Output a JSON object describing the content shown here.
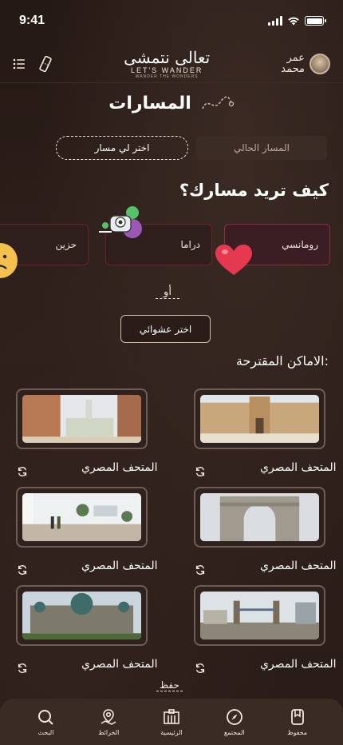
{
  "status": {
    "time": "9:41"
  },
  "header": {
    "user_name_1": "عمر",
    "user_name_2": "محمد",
    "logo_ar": "تعالى نتمشى",
    "logo_en": "LET'S WANDER",
    "logo_sub": "WANDER THE WONDERS"
  },
  "page": {
    "title": "المسارات",
    "tab_current": "المسار الحالي",
    "tab_choose": "اختر لي مسار",
    "question": "كيف تريد مسارك؟",
    "moods": [
      "رومانسي",
      "دراما",
      "حزين"
    ],
    "or_label": "أو",
    "random_button": "اختر عشوائي",
    "suggest_title": "الاماكن المقترحة:",
    "save_label": "حفظ"
  },
  "places": [
    {
      "label": "المتحف المصري"
    },
    {
      "label": "المتحف المصري"
    },
    {
      "label": "المتحف المصري"
    },
    {
      "label": "المتحف المصري"
    },
    {
      "label": "المتحف المصري"
    },
    {
      "label": "المتحف المصري"
    }
  ],
  "tabbar": {
    "saved": "محفوظ",
    "community": "المجتمع",
    "home": "الرئيسية",
    "maps": "الخرائط",
    "search": "البحث"
  },
  "colors": {
    "background": "#2a1c18",
    "accent_border": "#6b2333",
    "text": "#f3e8dc"
  }
}
